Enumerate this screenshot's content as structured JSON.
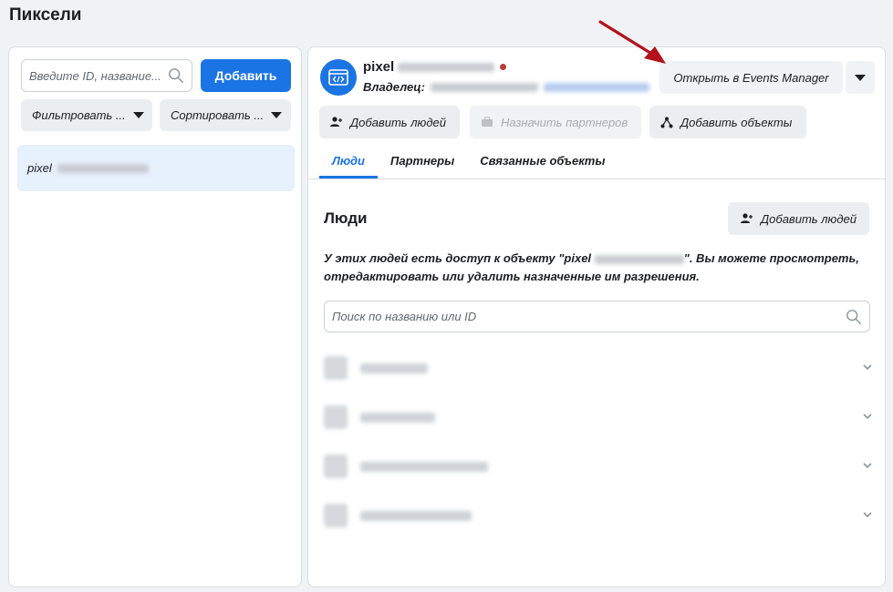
{
  "page": {
    "title": "Пиксели"
  },
  "left": {
    "search_placeholder": "Введите ID, название...",
    "add_label": "Добавить",
    "filter_label": "Фильтровать ...",
    "sort_label": "Сортировать ...",
    "list_item_prefix": "pixel"
  },
  "header": {
    "pixel_prefix": "pixel",
    "owner_label": "Владелец:",
    "open_events_manager_label": "Открыть в Events Manager",
    "status_color": "#bd3a3a"
  },
  "actions": {
    "add_people_label": "Добавить людей",
    "assign_partners_label": "Назначить партнеров",
    "add_objects_label": "Добавить объекты"
  },
  "tabs": [
    {
      "label": "Люди",
      "active": true
    },
    {
      "label": "Партнеры",
      "active": false
    },
    {
      "label": "Связанные объекты",
      "active": false
    }
  ],
  "people": {
    "title": "Люди",
    "add_people_label": "Добавить людей",
    "desc_part1": "У этих людей есть доступ к объекту \"pixel",
    "desc_part2": "\". Вы можете просмотреть, отредактировать или удалить назначенные им разрешения.",
    "search_placeholder": "Поиск по названию или ID"
  },
  "colors": {
    "accent": "#1b74e4",
    "arrow": "#b3121b"
  }
}
